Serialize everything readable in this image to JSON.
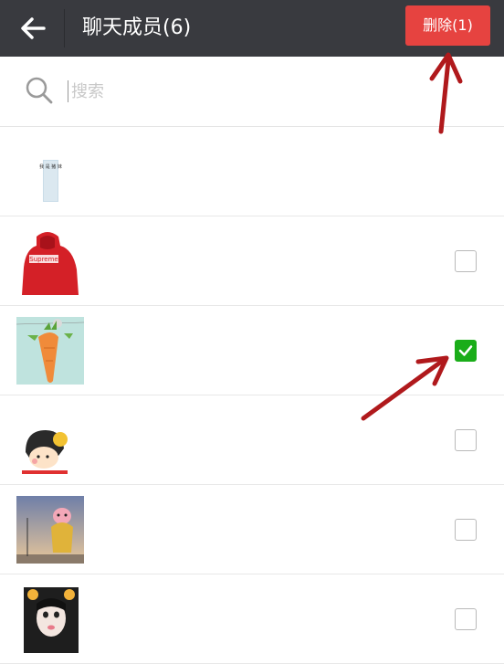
{
  "header": {
    "title": "聊天成员(6)",
    "delete_label": "删除(1)",
    "delete_color": "#e64340",
    "bar_color": "#393a3f"
  },
  "search": {
    "placeholder": "搜索"
  },
  "members": [
    {
      "avatar": "text-card-avatar",
      "selectable": false,
      "checked": false
    },
    {
      "avatar": "red-hoodie-avatar",
      "selectable": true,
      "checked": false
    },
    {
      "avatar": "carrot-avatar",
      "selectable": true,
      "checked": true
    },
    {
      "avatar": "cartoon-girl-avatar",
      "selectable": true,
      "checked": false
    },
    {
      "avatar": "pig-character-avatar",
      "selectable": true,
      "checked": false
    },
    {
      "avatar": "girl-photo-avatar",
      "selectable": true,
      "checked": false
    }
  ],
  "accent_check_color": "#1aad19",
  "annotation_color": "#b0191c",
  "avatar_texts": {
    "hoodie": "Supreme",
    "card": "我 是 猪 妹"
  }
}
